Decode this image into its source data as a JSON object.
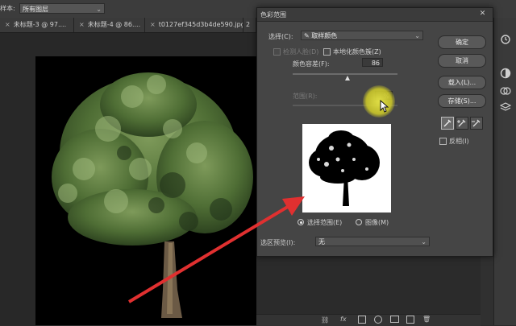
{
  "options_bar": {
    "label": "样本:",
    "select_value": "所有图层"
  },
  "tabs": [
    {
      "label": "未标题-3 @ 97...."
    },
    {
      "label": "未标题-4 @ 86...."
    },
    {
      "label": "t0127ef345d3b4de590.jpg"
    },
    {
      "label": "2"
    }
  ],
  "dialog": {
    "title": "色彩范围",
    "close_glyph": "✕",
    "select_label": "选择(C):",
    "select_value": "取样颜色",
    "detect_faces_label": "检测人脸(D)",
    "localized_clusters_label": "本地化颜色簇(Z)",
    "fuzziness_label": "颜色容差(F):",
    "fuzziness_value": "86",
    "fuzziness_fraction": 0.52,
    "range_label": "范围(R):",
    "range_value": "%",
    "selection_radio": "选择范围(E)",
    "image_radio": "图像(M)",
    "preview_label": "选区预览(I):",
    "preview_value": "无",
    "buttons": {
      "ok": "确定",
      "cancel": "取消",
      "load": "载入(L)...",
      "save": "存储(S)..."
    },
    "invert_label": "反相(I)"
  },
  "colors": {
    "accent_arrow": "#e03030",
    "highlight": "#e6e24a"
  }
}
